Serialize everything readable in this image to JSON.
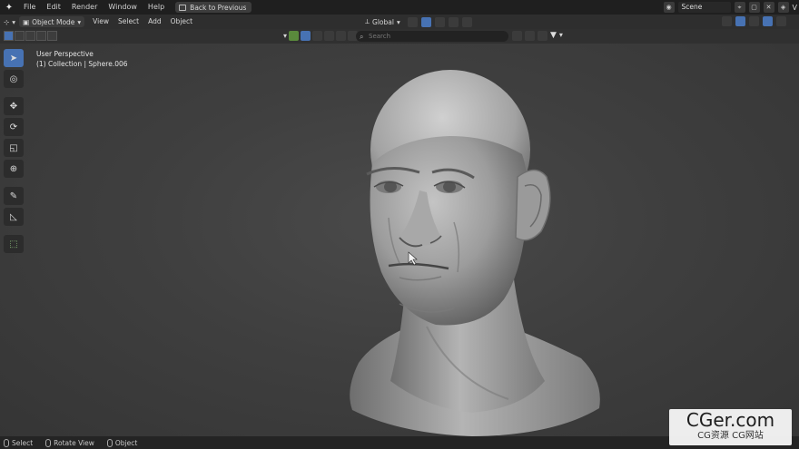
{
  "topbar": {
    "menu": [
      "File",
      "Edit",
      "Render",
      "Window",
      "Help"
    ],
    "back_button": "Back to Previous",
    "scene_name": "Scene",
    "view_layer_initial": "V"
  },
  "header": {
    "mode": "Object Mode",
    "menus": [
      "View",
      "Select",
      "Add",
      "Object"
    ],
    "transform_orientation": "Global"
  },
  "toolbar2": {
    "search_placeholder": "Search"
  },
  "viewport": {
    "perspective_label": "User Perspective",
    "object_label": "(1) Collection | Sphere.006"
  },
  "tools": [
    "select-box-icon",
    "cursor-icon",
    "move-icon",
    "rotate-icon",
    "scale-icon",
    "transform-icon",
    "annotate-icon",
    "measure-icon",
    "add-cube-icon"
  ],
  "statusbar": {
    "items": [
      "Select",
      "Rotate View",
      "Object"
    ]
  },
  "watermark": {
    "main": "CGer.com",
    "sub": "CG资源 CG网站"
  },
  "colors": {
    "accent": "#4772b3",
    "viewport_bg": "#404040",
    "sculpt_clay": "#9a9a9a"
  }
}
